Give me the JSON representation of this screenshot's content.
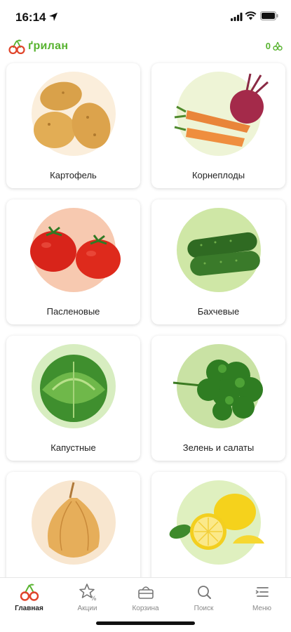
{
  "status_bar": {
    "time": "16:14"
  },
  "header": {
    "logo_text": "ґрилан",
    "cart_count": "0"
  },
  "categories": [
    {
      "label": "Картофель",
      "bg": "#fbeedb",
      "icon": "potato-icon"
    },
    {
      "label": "Корнеплоды",
      "bg": "#eef4d6",
      "icon": "root-vegetables-icon"
    },
    {
      "label": "Пасленовые",
      "bg": "#f7c9b0",
      "icon": "tomato-icon"
    },
    {
      "label": "Бахчевые",
      "bg": "#cfe7a6",
      "icon": "cucumber-icon"
    },
    {
      "label": "Капустные",
      "bg": "#d7edc0",
      "icon": "cabbage-icon"
    },
    {
      "label": "Зелень и салаты",
      "bg": "#c9e2a4",
      "icon": "parsley-icon"
    },
    {
      "label": "",
      "bg": "#f8e6cf",
      "icon": "onion-icon"
    },
    {
      "label": "",
      "bg": "#dff0bf",
      "icon": "lemon-icon"
    }
  ],
  "tabbar": {
    "home": "Главная",
    "promo": "Акции",
    "cart": "Корзина",
    "search": "Поиск",
    "menu": "Меню"
  },
  "colors": {
    "brand_green": "#58b330",
    "brand_red": "#e0452b"
  }
}
